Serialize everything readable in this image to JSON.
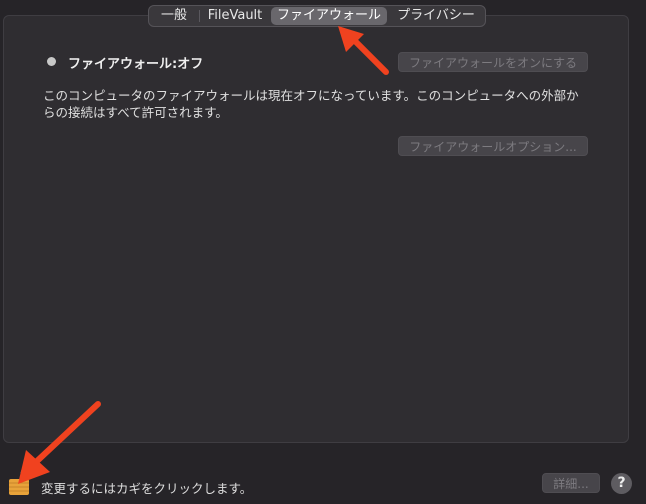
{
  "tabs": [
    {
      "label": "一般"
    },
    {
      "label": "FileVault"
    },
    {
      "label": "ファイアウォール",
      "selected": true
    },
    {
      "label": "プライバシー"
    }
  ],
  "firewall": {
    "status_label": "ファイアウォール:オフ",
    "turn_on_button": "ファイアウォールをオンにする",
    "description": "このコンピュータのファイアウォールは現在オフになっています。このコンピュータへの外部からの接続はすべて許可されます。",
    "options_button": "ファイアウォールオプション..."
  },
  "footer": {
    "lock_text": "変更するにはカギをクリックします。",
    "advanced_button": "詳細...",
    "help_label": "?",
    "lock_icon": "unlocked-padlock-icon"
  },
  "colors": {
    "annotation_arrow": "#f0421f",
    "lock_body": "#e8a33a"
  }
}
